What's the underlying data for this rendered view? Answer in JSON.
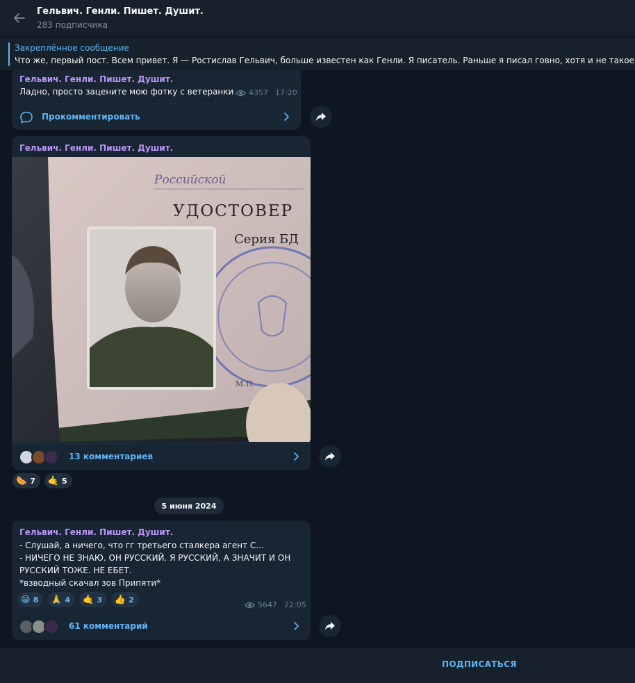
{
  "header": {
    "title": "Гельвич. Генли. Пишет. Душит.",
    "subscribers": "283 подписчика"
  },
  "pinned": {
    "label": "Закреплённое сообщение",
    "text": "Что же, первый пост. Всем привет. Я — Ростислав Гельвич, больше известен как Генли. Я писатель. Раньше я писал говно, хотя и не такое уж б"
  },
  "messages": [
    {
      "author": "Гельвич. Генли. Пишет. Душит.",
      "text": "Ладно, просто зацените мою фотку с ветеранки",
      "views": "4357",
      "time": "17:20",
      "comments_label": "Прокомментировать"
    },
    {
      "author": "Гельвич. Генли. Пишет. Душит.",
      "photo_text": {
        "line1": "Российской",
        "line2": "УДОСТОВЕР",
        "line3": "Серия  БД",
        "stamp": "М.П."
      },
      "comments_label": "13 комментариев",
      "reactions": [
        {
          "emoji": "🌭",
          "count": "7"
        },
        {
          "emoji": "🤙",
          "count": "5"
        }
      ]
    },
    {
      "author": "Гельвич. Генли. Пишет. Душит.",
      "lines": [
        "- Слушай, а ничего, что гг третьего сталкера агент С...",
        "- НИЧЕГО НЕ ЗНАЮ. ОН РУССКИЙ. Я РУССКИЙ, А ЗНАЧИТ И ОН",
        "РУССКИЙ ТОЖЕ. НЕ ЕБЕТ.",
        "*взводный скачал зов Припяти*"
      ],
      "reactions": [
        {
          "emoji": "😁",
          "count": "8"
        },
        {
          "emoji": "🙏",
          "count": "4"
        },
        {
          "emoji": "🤙",
          "count": "3"
        },
        {
          "emoji": "👍",
          "count": "2"
        }
      ],
      "views": "5647",
      "time": "22:05",
      "comments_label": "61 комментарий"
    }
  ],
  "date_separator": "5 июня 2024",
  "footer": {
    "subscribe_label": "ПОДПИСАТЬСЯ"
  },
  "colors": {
    "background": "#0e1621",
    "panel": "#17212b",
    "bubble": "#182533",
    "accent": "#5eb5f7",
    "author": "#b794f6"
  },
  "icons": [
    "back-arrow-icon",
    "eye-icon",
    "comment-icon",
    "chevron-right-icon",
    "share-icon"
  ]
}
